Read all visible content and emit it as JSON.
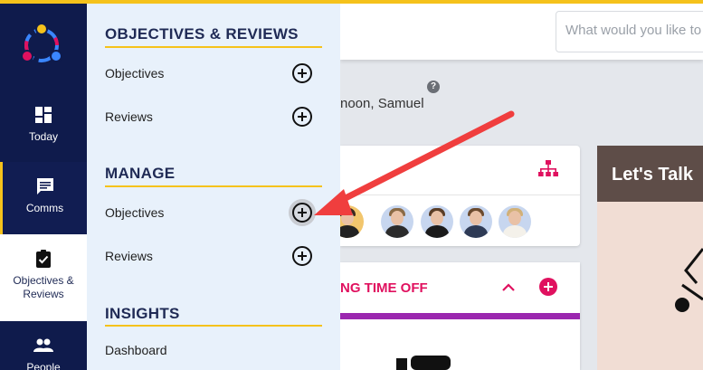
{
  "rail": {
    "today_label": "Today",
    "comms_label": "Comms",
    "objectives_label": "Objectives & Reviews",
    "people_label": "People"
  },
  "menu": {
    "sections": [
      {
        "title": "OBJECTIVES & REVIEWS",
        "items": [
          "Objectives",
          "Reviews"
        ]
      },
      {
        "title": "MANAGE",
        "items": [
          "Objectives",
          "Reviews"
        ]
      },
      {
        "title": "INSIGHTS",
        "items": [
          "Dashboard"
        ]
      }
    ]
  },
  "header": {
    "search_placeholder": "What would you like to"
  },
  "greeting": "noon, Samuel",
  "help_icon": "?",
  "timeoff": {
    "title": "NG TIME OFF"
  },
  "promo": {
    "title": "Let's Talk"
  },
  "colors": {
    "rail": "#0f1b4c",
    "accent": "#f5c21b",
    "pink": "#e0115f",
    "purple": "#9b27af",
    "annotation_arrow": "#f03e3e"
  }
}
